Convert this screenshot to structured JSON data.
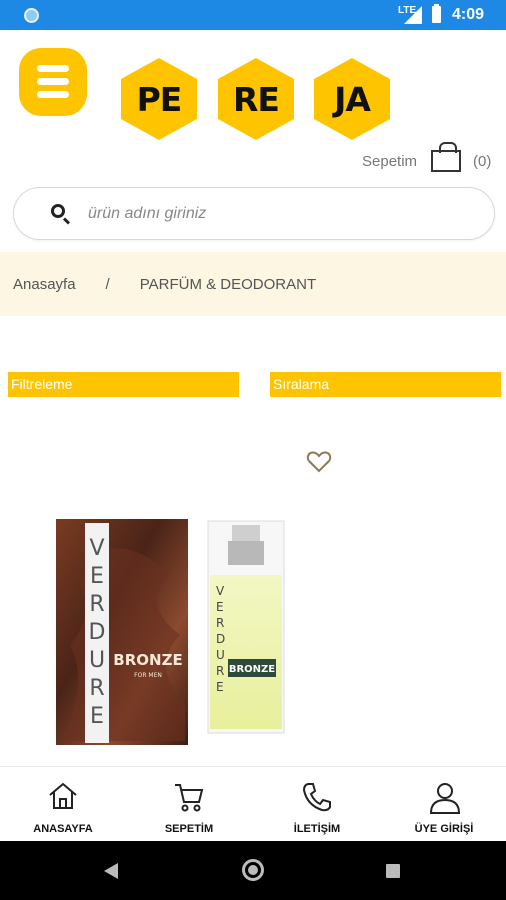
{
  "status_bar": {
    "network": "LTE",
    "time": "4:09"
  },
  "header": {
    "menu_icon": "hamburger-menu-icon",
    "logo_parts": [
      "PE",
      "RE",
      "JA"
    ],
    "brand_color": "#ffc400"
  },
  "cart": {
    "label": "Sepetim",
    "count": "(0)",
    "icon": "shopping-bag-icon"
  },
  "search": {
    "placeholder": "ürün adını giriniz",
    "icon": "search-icon"
  },
  "breadcrumb": {
    "home": "Anasayfa",
    "separator": "/",
    "current": "PARFÜM & DEODORANT"
  },
  "toolbar": {
    "filter_label": "Filtreleme",
    "sort_label": "Sıralama"
  },
  "product": {
    "favorite_icon": "heart-icon",
    "box_brand": "VERDURE",
    "box_name": "BRONZE",
    "box_subtitle": "FOR MEN"
  },
  "bottom_nav": [
    {
      "label": "ANASAYFA",
      "icon": "home-icon"
    },
    {
      "label": "SEPETİM",
      "icon": "cart-icon"
    },
    {
      "label": "İLETİŞİM",
      "icon": "phone-icon"
    },
    {
      "label": "ÜYE GİRİŞİ",
      "icon": "user-icon"
    }
  ]
}
